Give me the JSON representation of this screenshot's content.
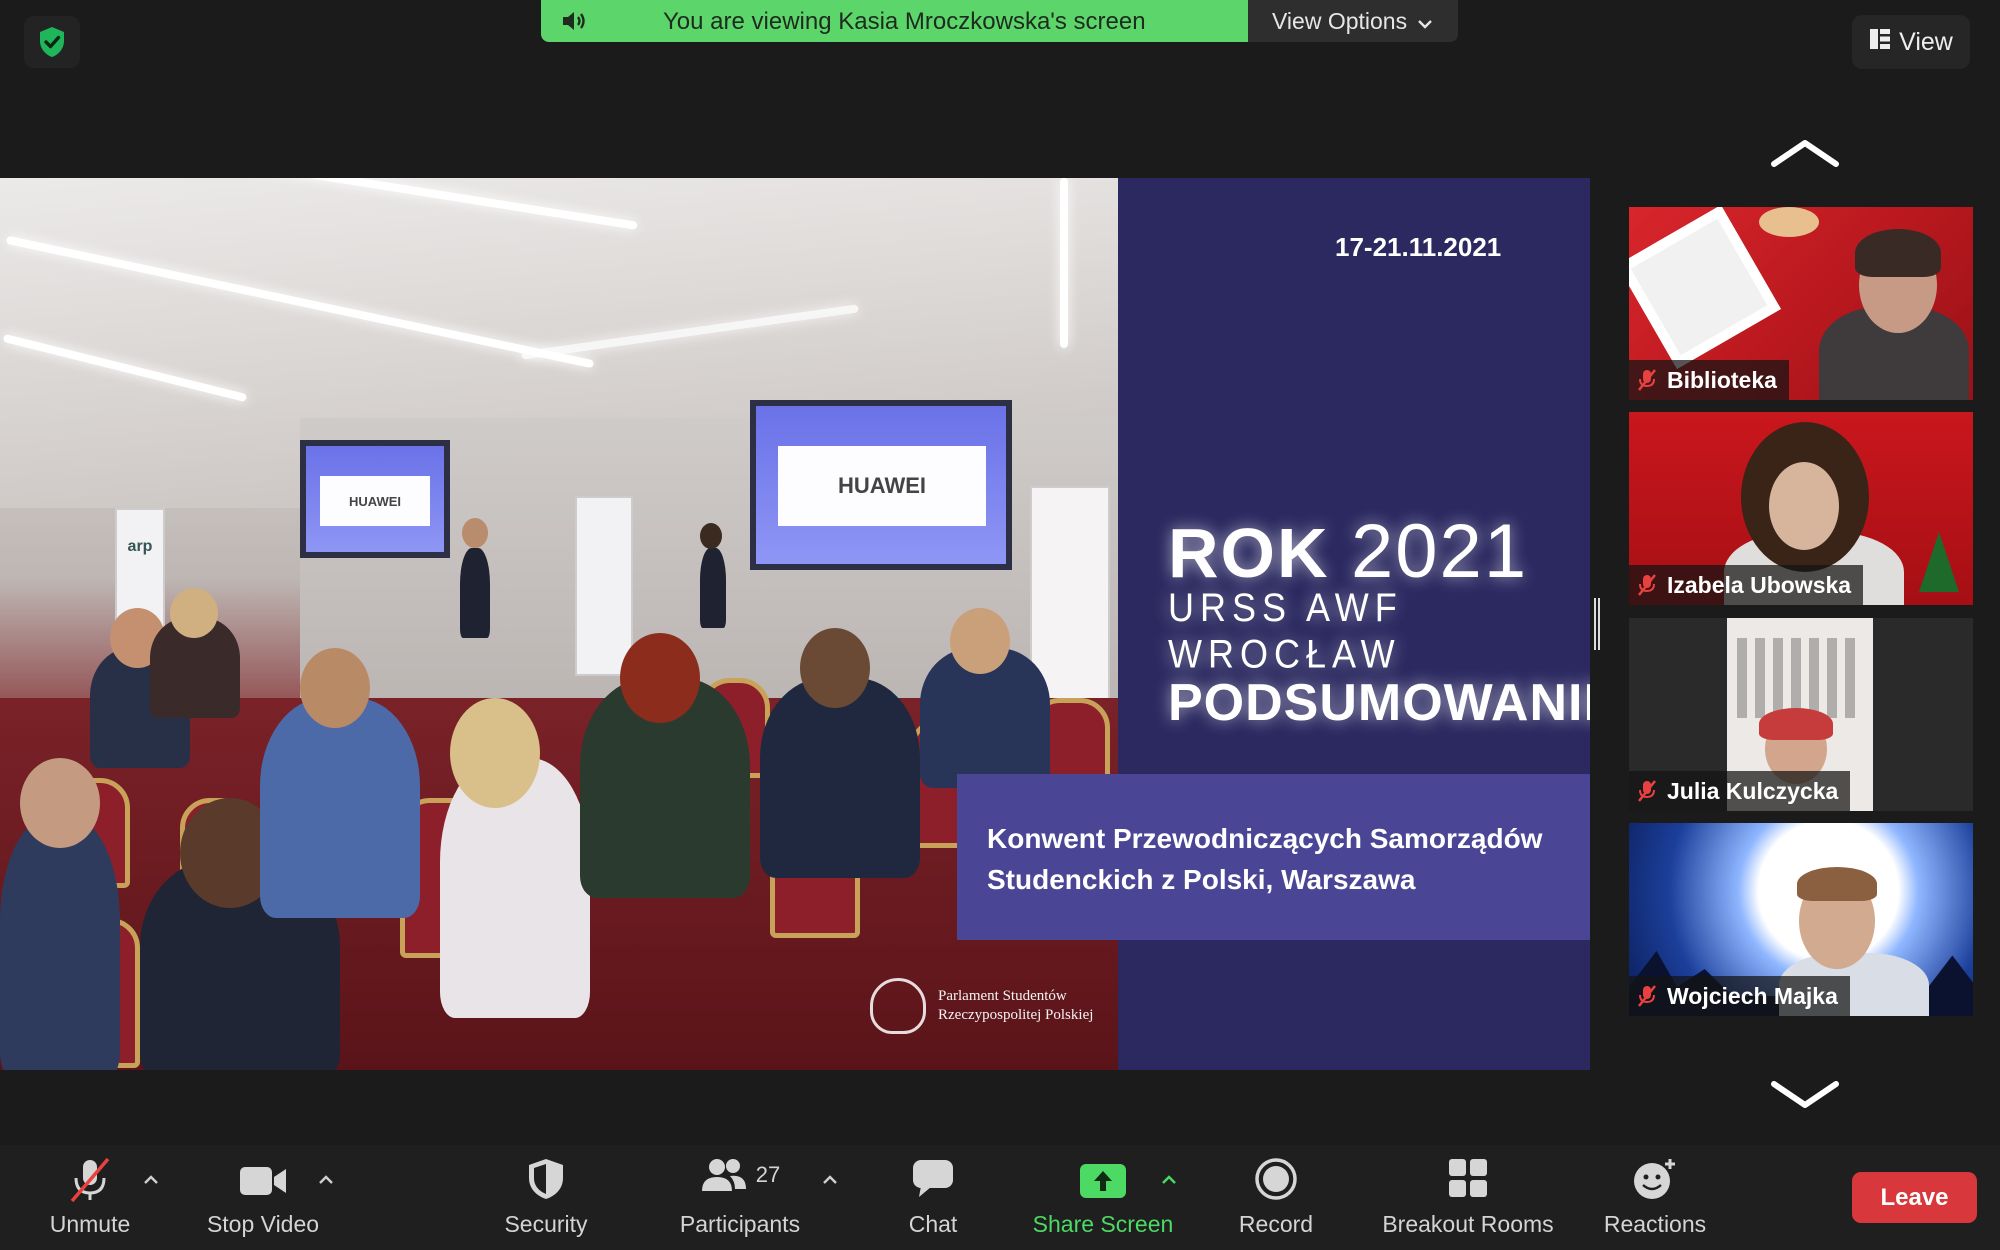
{
  "window": {
    "banner_text": "You are viewing Kasia Mroczkowska's screen",
    "view_options_label": "View Options",
    "view_button_label": "View",
    "colors": {
      "banner_green": "#5cd66a",
      "leave_red": "#d8373b",
      "share_screen_green": "#4cd964"
    }
  },
  "shared_slide": {
    "date": "17-21.11.2021",
    "title_word": "ROK",
    "title_year": "2021",
    "subtitle": "URSS AWF WROCŁAW",
    "headline": "PODSUMOWANIE",
    "caption_line1": "Konwent Przewodniczących Samorządów",
    "caption_line2": "Studenckich z Polski, Warszawa",
    "logo_line1": "Parlament Studentów",
    "logo_line2": "Rzeczypospolitej Polskiej",
    "photo_screen_left": "HUAWEI",
    "photo_screen_right": "HUAWEI",
    "photo_banner_brand": "arp"
  },
  "gallery": {
    "participants": [
      {
        "name": "Biblioteka",
        "muted": true
      },
      {
        "name": "Izabela Ubowska",
        "muted": true
      },
      {
        "name": "Julia Kulczycka",
        "muted": true
      },
      {
        "name": "Wojciech Majka",
        "muted": true
      }
    ]
  },
  "toolbar": {
    "unmute_label": "Unmute",
    "stop_video_label": "Stop Video",
    "security_label": "Security",
    "participants_label": "Participants",
    "participants_count": "27",
    "chat_label": "Chat",
    "share_screen_label": "Share Screen",
    "record_label": "Record",
    "breakout_rooms_label": "Breakout Rooms",
    "reactions_label": "Reactions",
    "leave_label": "Leave"
  }
}
